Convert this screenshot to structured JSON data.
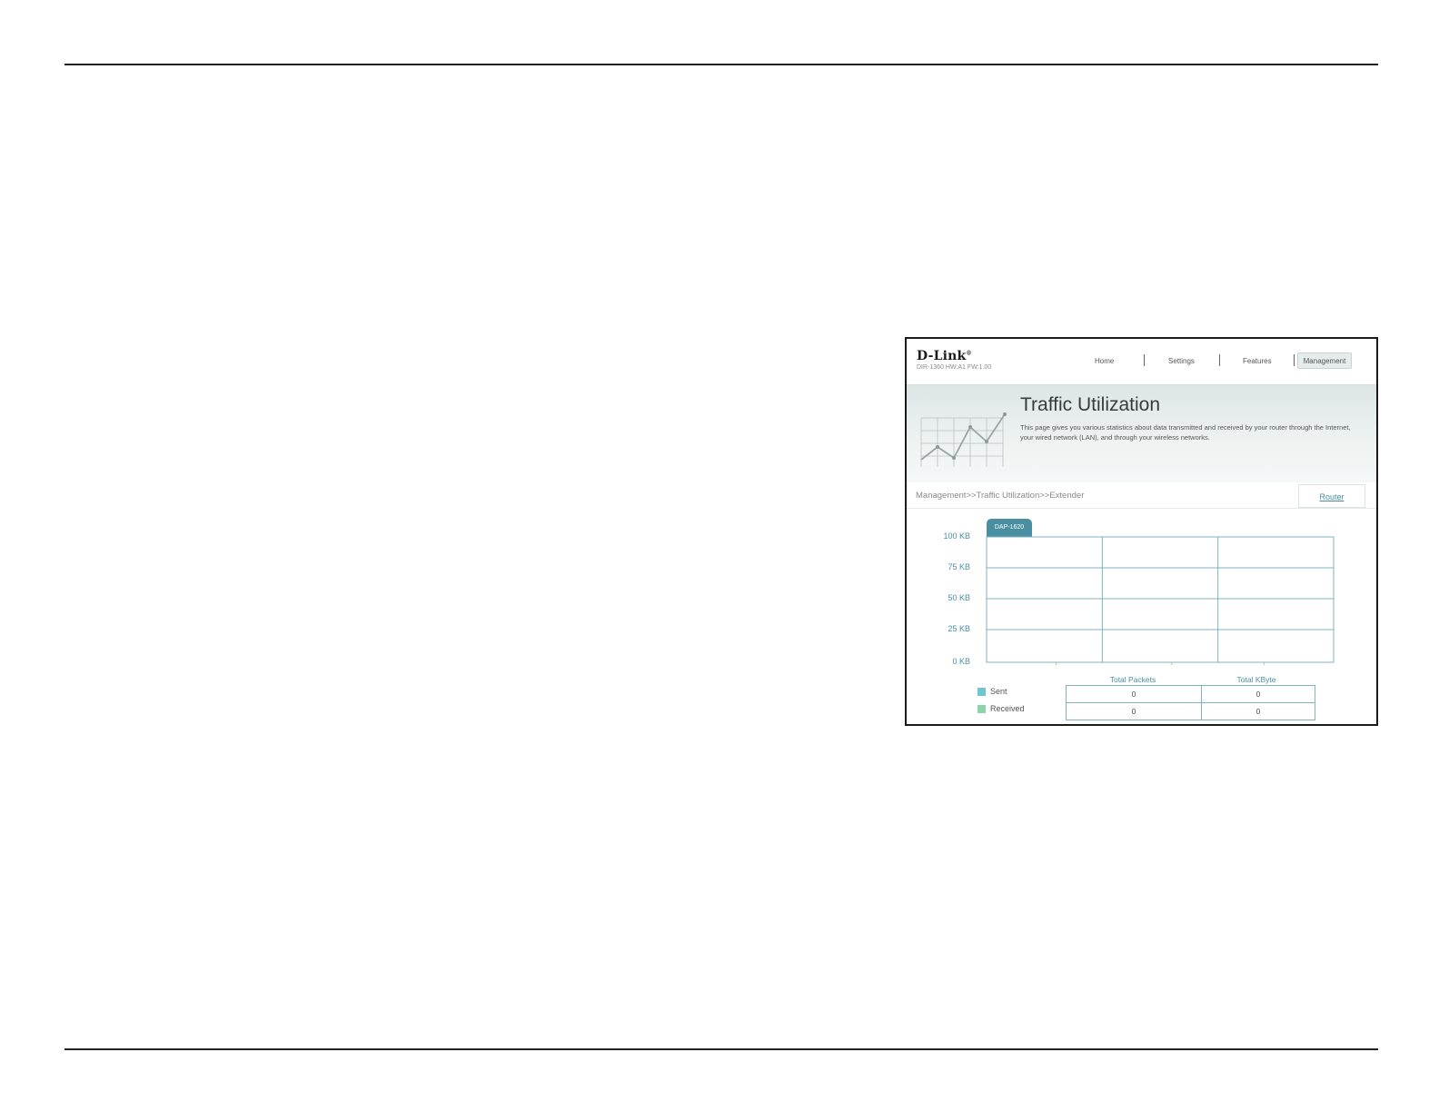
{
  "app": {
    "logo": "D-Link",
    "model_info": "DIR-1360 HW:A1 FW:1.00",
    "nav": [
      {
        "label": "Home",
        "active": false
      },
      {
        "label": "Settings",
        "active": false
      },
      {
        "label": "Features",
        "active": false
      },
      {
        "label": "Management",
        "active": true
      }
    ]
  },
  "banner": {
    "title": "Traffic Utilization",
    "description": "This page gives you various statistics about data transmitted and received by your router through the Internet, your wired network (LAN), and through your wireless networks."
  },
  "breadcrumb": "Management>>Traffic Utilization>>Extender",
  "router_button": "Router",
  "device_tab": "DAP-1620",
  "chart_data": {
    "type": "line",
    "y_tick_labels": [
      "100 KB",
      "75 KB",
      "50 KB",
      "25 KB",
      "0 KB"
    ],
    "ylim": [
      0,
      100
    ],
    "grid": true,
    "series": [
      {
        "name": "Sent",
        "values": [],
        "color": "#6ec6cf"
      },
      {
        "name": "Received",
        "values": [],
        "color": "#8fd3a8"
      }
    ]
  },
  "stats": {
    "columns": [
      "Total Packets",
      "Total KByte"
    ],
    "rows": [
      {
        "label": "Sent",
        "color": "#6ec6cf",
        "packets": "0",
        "kbyte": "0"
      },
      {
        "label": "Received",
        "color": "#8fd3a8",
        "packets": "0",
        "kbyte": "0"
      }
    ]
  },
  "colors": {
    "accent": "#4a8fa1",
    "link": "#4a8f9f"
  }
}
